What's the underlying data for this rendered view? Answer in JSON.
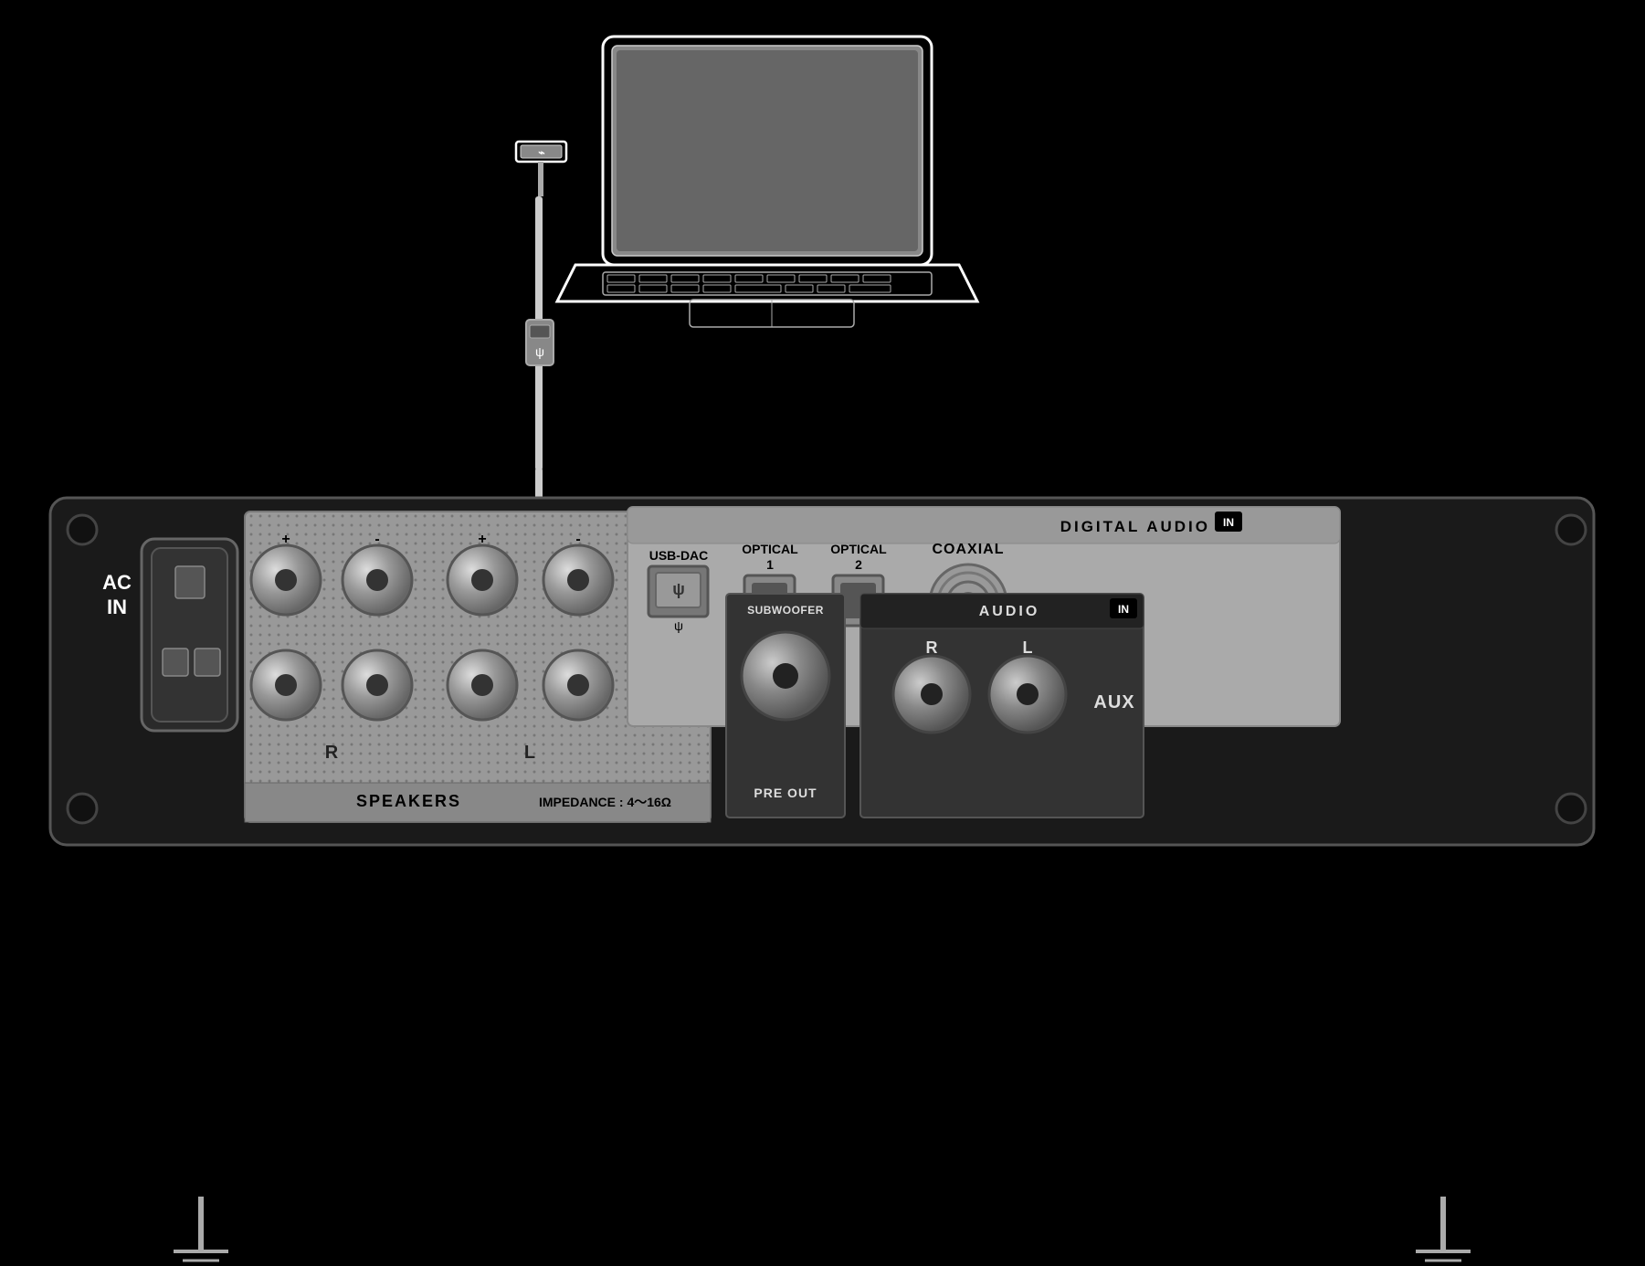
{
  "background": "#000000",
  "labels": {
    "ac_in": "AC\nIN",
    "speakers": "SPEAKERS",
    "impedance": "IMPEDANCE : 4～16Ω",
    "pre_out": "PRE OUT",
    "subwoofer": "SUBWOOFER",
    "digital_audio": "DIGITAL AUDIO",
    "digital_in_badge": "IN",
    "usb_dac": "USB-DAC",
    "optical_1": "OPTICAL\n1",
    "optical_2": "OPTICAL\n2",
    "coaxial": "COAXIAL",
    "audio_in_title": "AUDIO",
    "audio_in_badge": "IN",
    "aux": "AUX",
    "r_label": "R",
    "l_label": "L",
    "speaker_plus1": "+",
    "speaker_minus1": "-",
    "speaker_plus2": "+",
    "speaker_minus2": "-",
    "speaker_r": "R",
    "speaker_l": "L"
  },
  "colors": {
    "background": "#000000",
    "panel_bg": "#1a1a1a",
    "panel_border": "#555555",
    "speaker_bg": "#999999",
    "digital_bg": "#aaaaaa",
    "audio_bg": "#333333",
    "text_white": "#ffffff",
    "text_black": "#000000",
    "text_light": "#dddddd"
  }
}
